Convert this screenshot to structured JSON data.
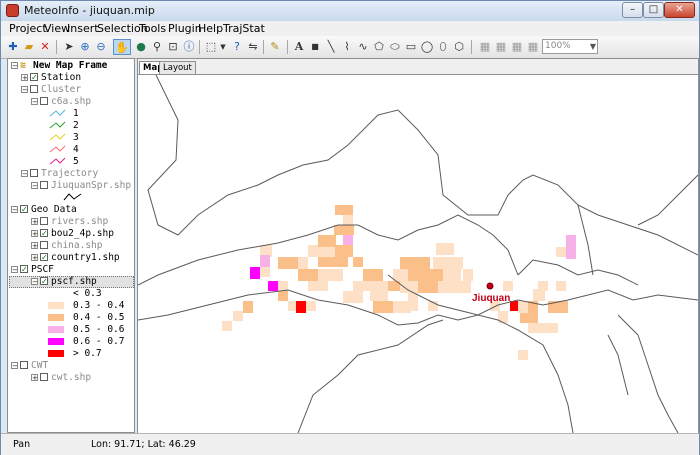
{
  "window": {
    "title": "MeteoInfo - jiuquan.mip",
    "min": "–",
    "max": "□",
    "close": "✕"
  },
  "menu": [
    "Project",
    "View",
    "Insert",
    "Selection",
    "Tools",
    "Plugin",
    "Help",
    "TrajStat"
  ],
  "toolbar": {
    "zoom_value": "100%"
  },
  "tree": {
    "root": "New Map Frame",
    "station": "Station",
    "cluster": "Cluster",
    "cluster_file": "c6a.shp",
    "cluster_items": [
      "1",
      "2",
      "3",
      "4",
      "5"
    ],
    "cluster_colors": [
      "#4fb3e0",
      "#2ca02c",
      "#e6d21a",
      "#ff6b6b",
      "#e0208a"
    ],
    "trajectory": "Trajectory",
    "traj_file": "JiuquanSpr.shp",
    "geodata": "Geo Data",
    "geo_files": [
      "rivers.shp",
      "bou2_4p.shp",
      "china.shp",
      "country1.shp"
    ],
    "pscf": "PSCF",
    "pscf_file": "pscf.shp",
    "pscf_legend": [
      "< 0.3",
      "0.3 - 0.4",
      "0.4 - 0.5",
      "0.5 - 0.6",
      "0.6 - 0.7",
      "> 0.7"
    ],
    "pscf_colors": [
      "#ffffff",
      "#fde0c5",
      "#fbbf8a",
      "#f7b0e8",
      "#ff00ff",
      "#ff0000"
    ],
    "cwt": "CWT",
    "cwt_file": "cwt.shp"
  },
  "tabs": [
    "Map",
    "Layout"
  ],
  "map": {
    "city_label": "Jiuquan"
  },
  "status": {
    "mode": "Pan",
    "coords": "Lon: 91.71; Lat: 46.29"
  }
}
